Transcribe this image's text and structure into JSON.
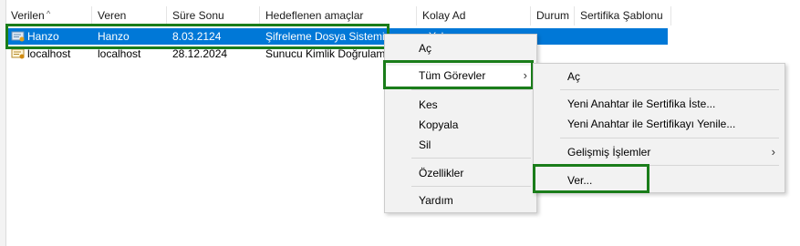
{
  "columns": [
    "Verilen",
    "Veren",
    "Süre Sonu",
    "Hedeflenen amaçlar",
    "Kolay Ad",
    "Durum",
    "Sertifika Şablonu"
  ],
  "rows": [
    {
      "issued_to": "Hanzo",
      "issued_by": "Hanzo",
      "expires": "8.03.2124",
      "purposes": "Şifreleme Dosya Sistemi",
      "friendly": "<Yok>",
      "icon": "certificate-icon"
    },
    {
      "issued_to": "localhost",
      "issued_by": "localhost",
      "expires": "28.12.2024",
      "purposes": "Sunucu Kimlik Doğrulam",
      "friendly": "",
      "icon": "certificate-icon"
    }
  ],
  "context_menu": {
    "open": "Aç",
    "all_tasks": "Tüm Görevler",
    "cut": "Kes",
    "copy": "Kopyala",
    "delete": "Sil",
    "properties": "Özellikler",
    "help": "Yardım"
  },
  "submenu": {
    "open": "Aç",
    "request_new_key": "Yeni Anahtar ile Sertifika İste...",
    "renew_new_key": "Yeni Anahtar ile Sertifikayı Yenile...",
    "advanced": "Gelişmiş İşlemler",
    "export": "Ver..."
  },
  "colors": {
    "selection": "#0078d7",
    "highlight": "#1a7d1a"
  }
}
